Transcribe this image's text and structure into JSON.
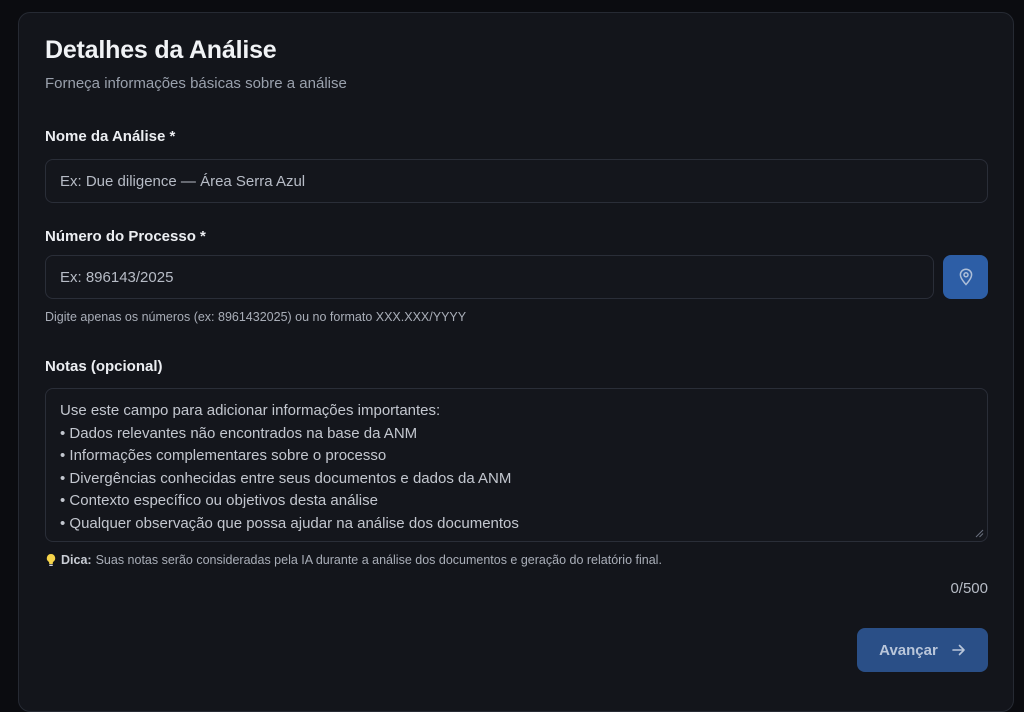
{
  "form": {
    "title": "Detalhes da Análise",
    "subtitle": "Forneça informações básicas sobre a análise",
    "name_field": {
      "label": "Nome da Análise *",
      "placeholder": "Ex: Due diligence — Área Serra Azul"
    },
    "process_field": {
      "label": "Número do Processo *",
      "placeholder": "Ex: 896143/2025",
      "helper": "Digite apenas os números (ex: 8961432025) ou no formato XXX.XXX/YYYY",
      "button_icon": "map-pin-icon"
    },
    "notes_field": {
      "label": "Notas (opcional)",
      "placeholder_lines": [
        "Use este campo para adicionar informações importantes:",
        "• Dados relevantes não encontrados na base da ANM",
        "• Informações complementares sobre o processo",
        "• Divergências conhecidas entre seus documentos e dados da ANM",
        "• Contexto específico ou objetivos desta análise",
        "• Qualquer observação que possa ajudar na análise dos documentos"
      ],
      "tip_icon": "lightbulb-icon",
      "tip_label": "Dica:",
      "tip_text": "Suas notas serão consideradas pela IA durante a análise dos documentos e geração do relatório final.",
      "counter": "0/500"
    },
    "next_button": {
      "label": "Avançar",
      "icon": "arrow-right-icon"
    }
  },
  "colors": {
    "background": "#0b0c10",
    "card": "#13151b",
    "accent": "#2d5ea6",
    "primary_button": "#2a4f87"
  }
}
